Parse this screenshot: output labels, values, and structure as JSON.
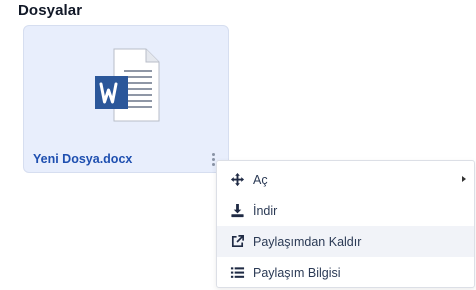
{
  "section": {
    "title": "Dosyalar"
  },
  "file": {
    "name": "Yeni Dosya.docx",
    "icon": "word-document-icon"
  },
  "context_menu": {
    "items": [
      {
        "label": "Aç",
        "icon": "move-arrows-icon",
        "has_submenu": true
      },
      {
        "label": "İndir",
        "icon": "download-icon",
        "has_submenu": false
      },
      {
        "label": "Paylaşımdan Kaldır",
        "icon": "external-link-icon",
        "has_submenu": false,
        "highlighted": true
      },
      {
        "label": "Paylaşım Bilgisi",
        "icon": "list-icon",
        "has_submenu": false
      }
    ]
  },
  "colors": {
    "card_background": "#e8eefc",
    "file_name": "#1e4fb0",
    "word_blue": "#2b579a",
    "menu_text": "#2b3a55",
    "menu_hover": "#f1f3f8"
  }
}
